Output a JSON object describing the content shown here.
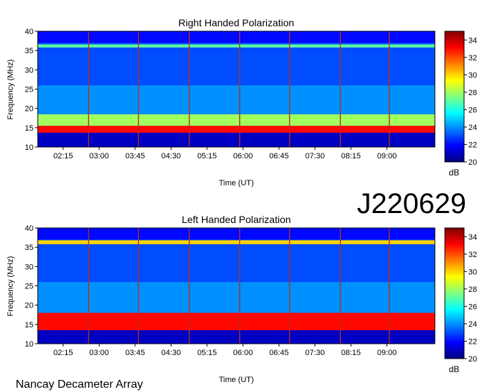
{
  "observation_id": "J220629",
  "observatory": "Nancay Decameter Array",
  "colorscale": {
    "ticks": [
      20,
      22,
      24,
      26,
      28,
      30,
      32,
      34
    ],
    "unit": "dB",
    "colors": [
      "#00007f",
      "#0000ff",
      "#007fff",
      "#00ffff",
      "#7fff7f",
      "#ffff00",
      "#ff7f00",
      "#ff0000",
      "#7f0000"
    ]
  },
  "chart_data": [
    {
      "type": "heatmap",
      "title": "Right Handed Polarization",
      "xlabel": "Time (UT)",
      "ylabel": "Frequency (MHz)",
      "x_tick_labels": [
        "02:15",
        "03:00",
        "03:45",
        "04:30",
        "05:15",
        "06:00",
        "06:45",
        "07:30",
        "08:15",
        "09:00"
      ],
      "x_tick_hours": [
        2.25,
        3.0,
        3.75,
        4.5,
        5.25,
        6.0,
        6.75,
        7.5,
        8.25,
        9.0
      ],
      "xlim_hours": [
        1.72,
        10.0
      ],
      "ylim": [
        10,
        40
      ],
      "y_ticks": [
        10,
        15,
        20,
        25,
        30,
        35,
        40
      ],
      "z_range_db": [
        20,
        35
      ],
      "vertical_markers_hours": [
        2.78,
        3.82,
        4.88,
        5.93,
        6.97,
        8.03,
        9.05
      ],
      "regions": [
        {
          "freq": [
            10,
            13.7
          ],
          "db": 21
        },
        {
          "freq": [
            13.7,
            15.5
          ],
          "db": 33
        },
        {
          "freq": [
            15.5,
            18.5
          ],
          "db": 28
        },
        {
          "freq": [
            18.5,
            26
          ],
          "db": 24
        },
        {
          "freq": [
            26,
            35
          ],
          "db": 23
        },
        {
          "freq": [
            35.8,
            36.6
          ],
          "db": 27
        },
        {
          "freq": [
            37,
            40
          ],
          "db": 22
        }
      ]
    },
    {
      "type": "heatmap",
      "title": "Left Handed Polarization",
      "xlabel": "Time (UT)",
      "ylabel": "Frequency (MHz)",
      "x_tick_labels": [
        "02:15",
        "03:00",
        "03:45",
        "04:30",
        "05:15",
        "06:00",
        "06:45",
        "07:30",
        "08:15",
        "09:00"
      ],
      "x_tick_hours": [
        2.25,
        3.0,
        3.75,
        4.5,
        5.25,
        6.0,
        6.75,
        7.5,
        8.25,
        9.0
      ],
      "xlim_hours": [
        1.72,
        10.0
      ],
      "ylim": [
        10,
        40
      ],
      "y_ticks": [
        10,
        15,
        20,
        25,
        30,
        35,
        40
      ],
      "z_range_db": [
        20,
        35
      ],
      "vertical_markers_hours": [
        2.78,
        3.82,
        4.88,
        5.93,
        6.97,
        8.03,
        9.05
      ],
      "regions": [
        {
          "freq": [
            10,
            13.5
          ],
          "db": 21
        },
        {
          "freq": [
            13.5,
            18
          ],
          "db": 33
        },
        {
          "freq": [
            18,
            26
          ],
          "db": 24
        },
        {
          "freq": [
            26,
            35
          ],
          "db": 23
        },
        {
          "freq": [
            35.8,
            36.8
          ],
          "db": 30
        },
        {
          "freq": [
            37,
            40
          ],
          "db": 22
        }
      ]
    }
  ]
}
